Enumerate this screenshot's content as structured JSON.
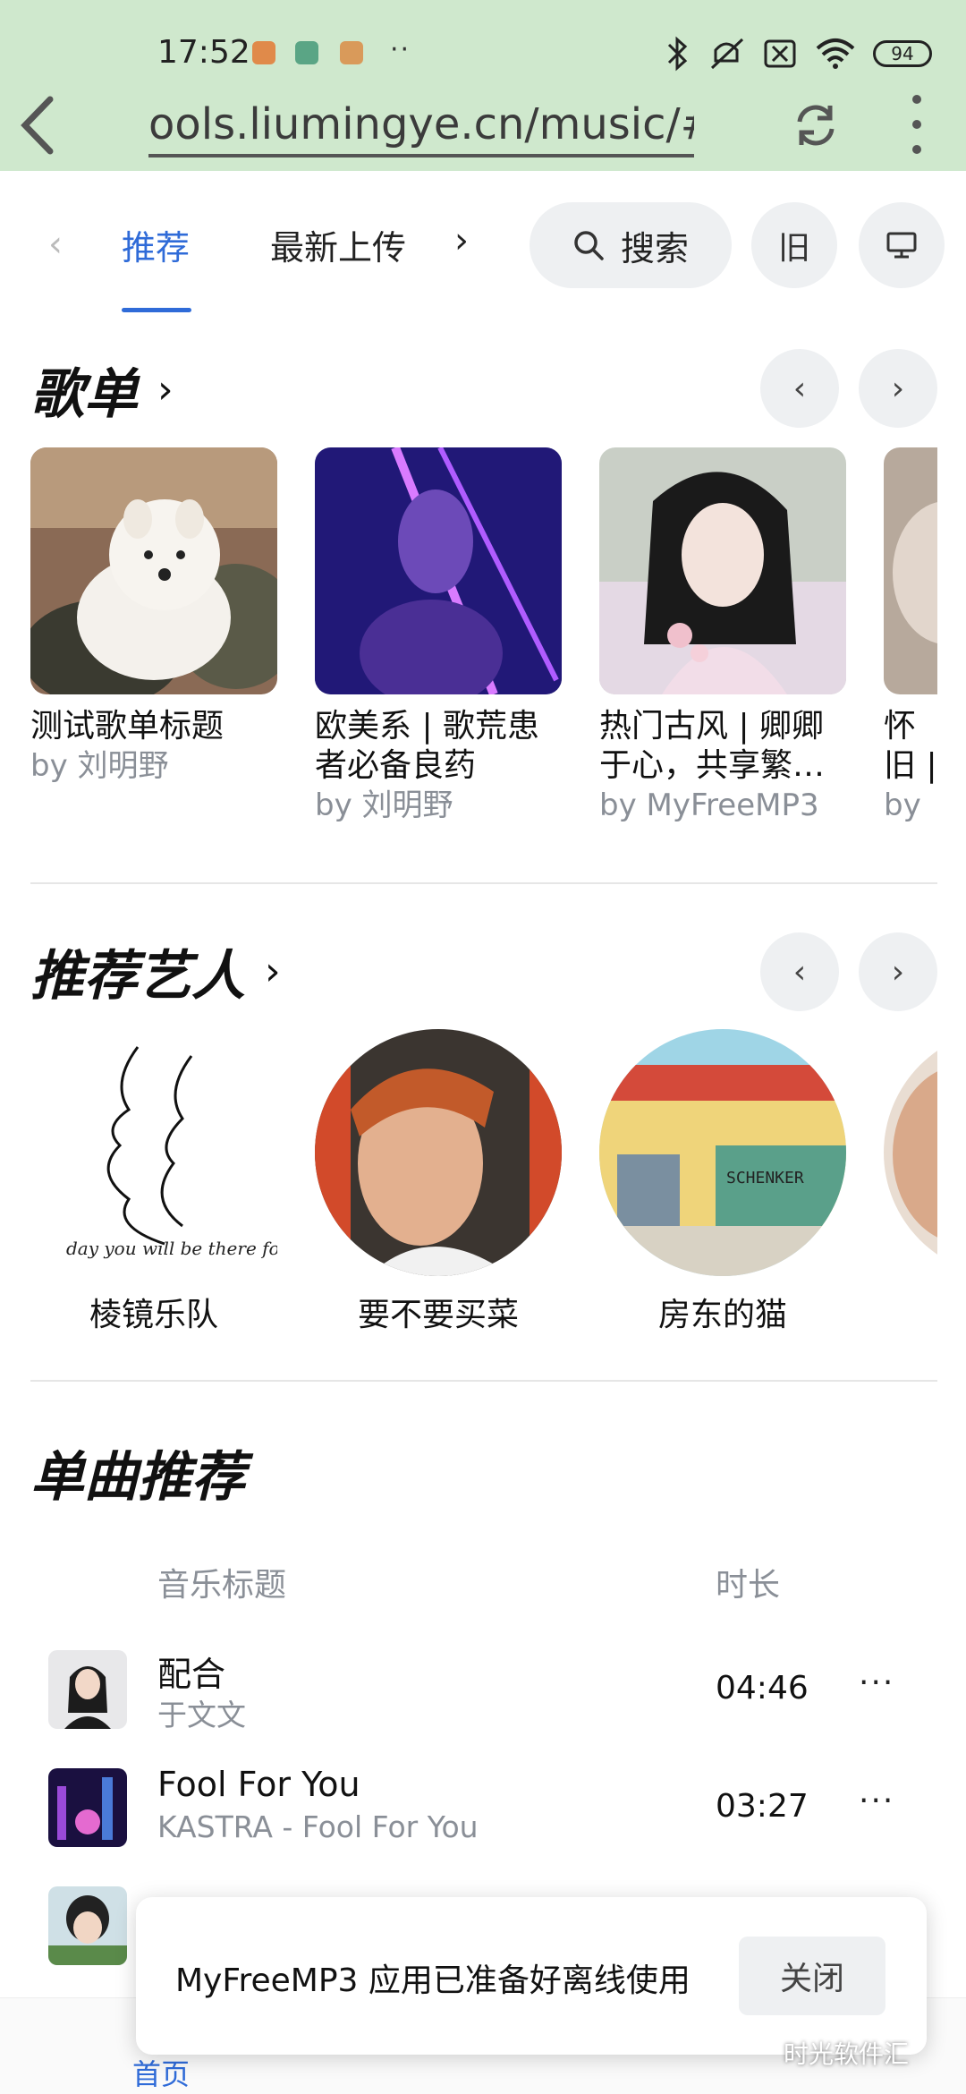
{
  "status_bar": {
    "time": "17:52",
    "battery": "94",
    "icons": [
      "app-notif-icon",
      "app-notif-icon",
      "app-notif-icon",
      "more-dots-icon",
      "bluetooth-icon",
      "mute-icon",
      "no-sim-icon",
      "wifi-icon",
      "battery-icon"
    ]
  },
  "url_bar": {
    "url": "ools.liumingye.cn/music/#/"
  },
  "nav": {
    "tabs": [
      {
        "label": "推荐",
        "active": true
      },
      {
        "label": "最新上传",
        "active": false
      }
    ],
    "search_label": "搜索",
    "old_label": "旧"
  },
  "playlists": {
    "title": "歌单",
    "cards": [
      {
        "title": "测试歌单标题",
        "by": "by 刘明野"
      },
      {
        "title": "欧美系 | 歌荒患者必备良药",
        "by": "by 刘明野"
      },
      {
        "title": "热门古风 | 卿卿于心，共享繁…",
        "by": "by MyFreeMP3"
      },
      {
        "title": "怀旧 | 时",
        "by": "by"
      }
    ]
  },
  "artists": {
    "title": "推荐艺人",
    "items": [
      {
        "name": "棱镜乐队"
      },
      {
        "name": "要不要买菜"
      },
      {
        "name": "房东的猫"
      },
      {
        "name": ""
      }
    ],
    "artwork_text": {
      "sketch_caption": "day you will be there for",
      "truck_sign": "SCHENKER"
    }
  },
  "songs": {
    "title": "单曲推荐",
    "col_title": "音乐标题",
    "col_duration": "时长",
    "rows": [
      {
        "title": "配合",
        "artist": "于文文",
        "duration": "04:46"
      },
      {
        "title": "Fool For You",
        "artist": "KASTRA - Fool For You",
        "duration": "03:27"
      }
    ]
  },
  "toast": {
    "message": "MyFreeMP3 应用已准备好离线使用",
    "close_label": "关闭"
  },
  "bottom_nav": {
    "home_label": "首页"
  },
  "watermark": "时光软件汇",
  "colors": {
    "accent": "#2f6bd8",
    "chrome_bg": "#cfe8cd",
    "muted_text": "#8a8f97"
  }
}
